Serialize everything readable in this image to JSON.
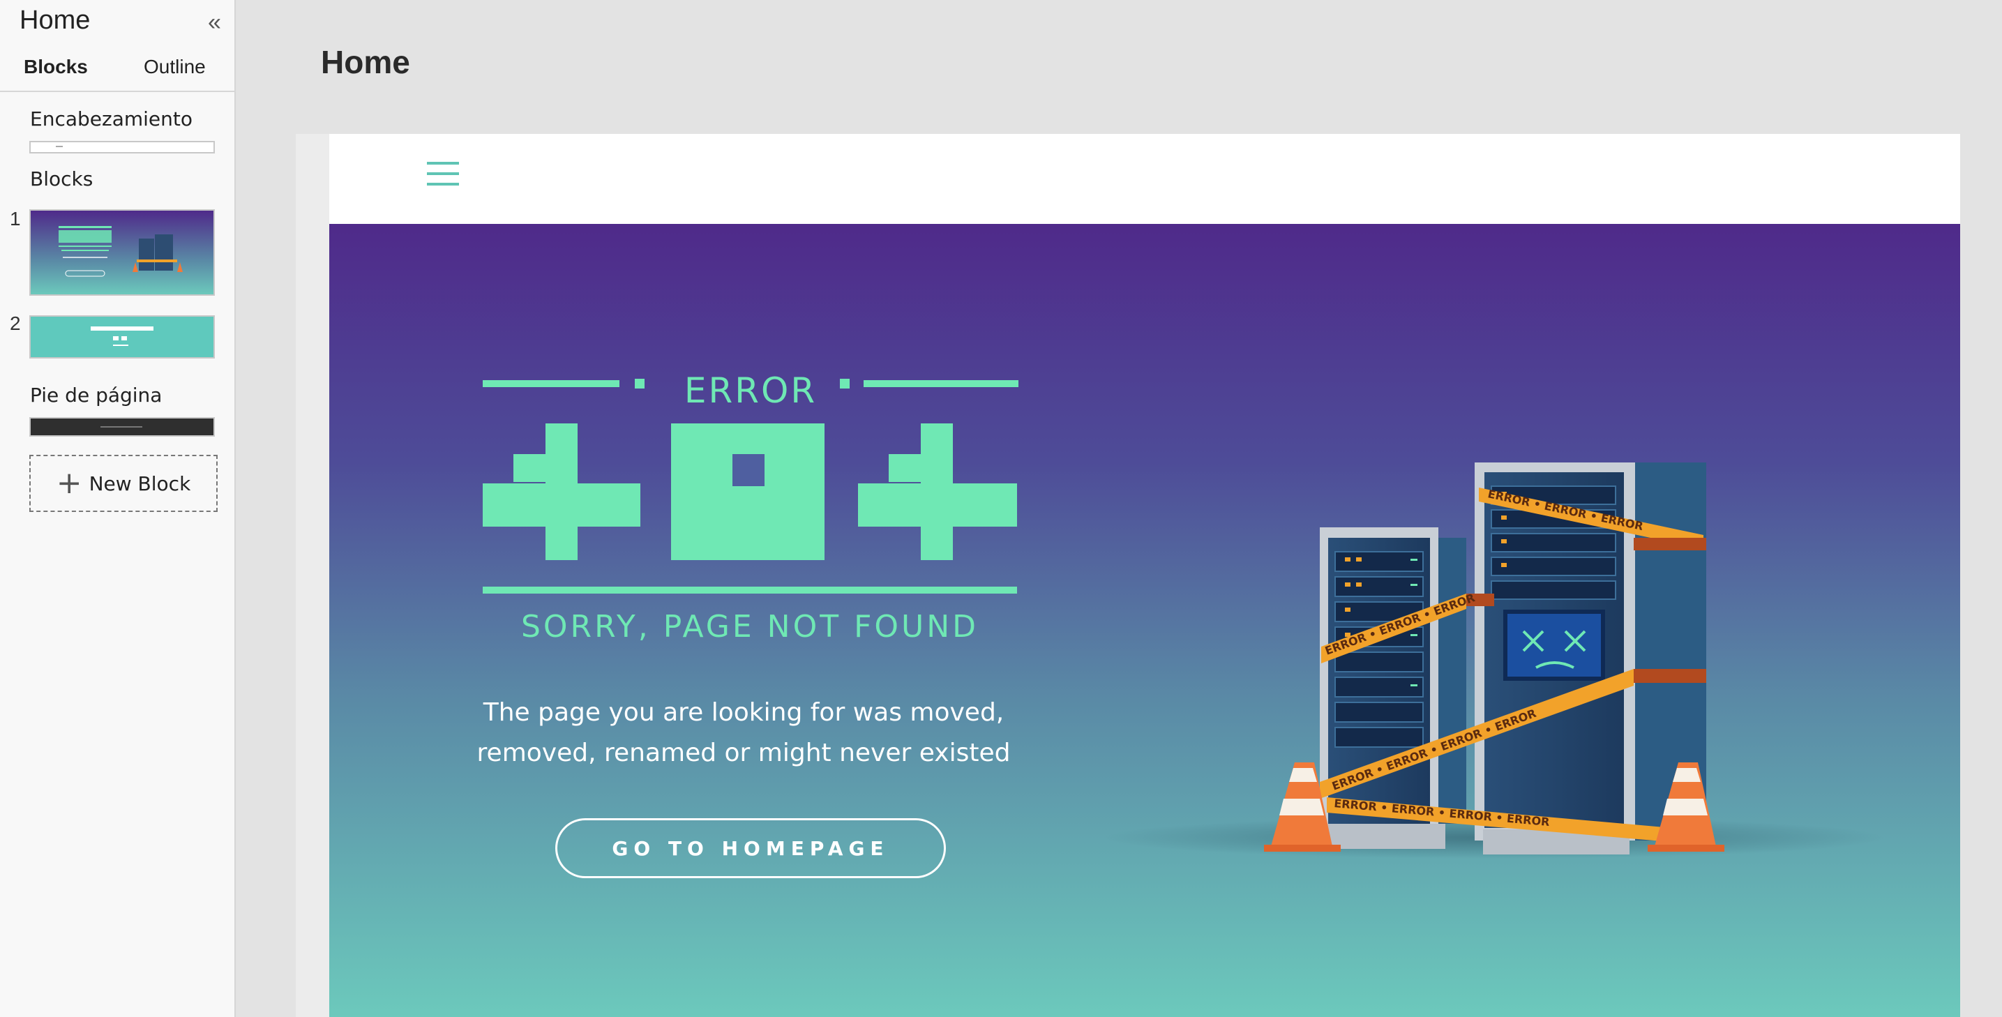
{
  "sidebar": {
    "title": "Home",
    "tabs": [
      {
        "label": "Blocks"
      },
      {
        "label": "Outline"
      }
    ],
    "header_label": "Encabezamiento",
    "blocks_label": "Blocks",
    "blocks": [
      {
        "number": "1"
      },
      {
        "number": "2"
      }
    ],
    "footer_label": "Pie de página",
    "new_block_label": "New Block"
  },
  "main": {
    "page_title": "Home"
  },
  "hero": {
    "error_label": "ERROR",
    "code": "404",
    "subtitle": "SORRY, PAGE NOT FOUND",
    "message_line1": "The page you are looking for was moved,",
    "message_line2": "removed, renamed or might never existed",
    "button_label": "GO TO HOMEPAGE",
    "illustration_texts": [
      "ERROR • ERROR • ERROR",
      "ERROR • ERROR • ERROR",
      "ERROR • ERROR • ERROR • ERROR",
      "ERROR • ERROR • ERROR • ERROR"
    ]
  },
  "colors": {
    "accent": "#6fe8b4",
    "teal": "#5fc4b4",
    "purple_top": "#4f2a8a",
    "teal_bottom": "#6cc9bc"
  }
}
